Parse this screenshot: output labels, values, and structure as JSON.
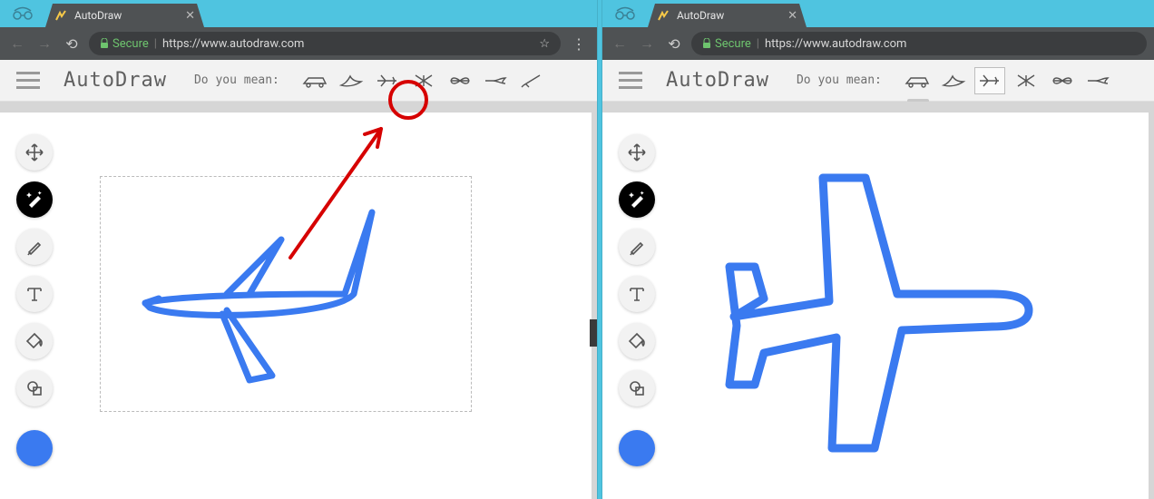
{
  "left": {
    "tab_title": "AutoDraw",
    "secure_label": "Secure",
    "url": "https://www.autodraw.com",
    "app_title": "AutoDraw",
    "suggestion_label": "Do you mean:",
    "suggestions": [
      "car",
      "bird",
      "airplane",
      "mosquito",
      "dragonfly",
      "swordfish",
      "sword"
    ],
    "circled_suggestion_index": 2,
    "selected_suggestion_index": null,
    "drawing": "hand-drawn-airplane",
    "color": "#3a7af0"
  },
  "right": {
    "tab_title": "AutoDraw",
    "secure_label": "Secure",
    "url": "https://www.autodraw.com",
    "app_title": "AutoDraw",
    "suggestion_label": "Do you mean:",
    "suggestions": [
      "car",
      "bird",
      "airplane",
      "mosquito",
      "dragonfly",
      "swordfish"
    ],
    "selected_suggestion_index": 2,
    "drawing": "clean-airplane",
    "color": "#3a7af0"
  },
  "tools": [
    "move",
    "autodraw",
    "draw",
    "text",
    "fill",
    "shape"
  ]
}
